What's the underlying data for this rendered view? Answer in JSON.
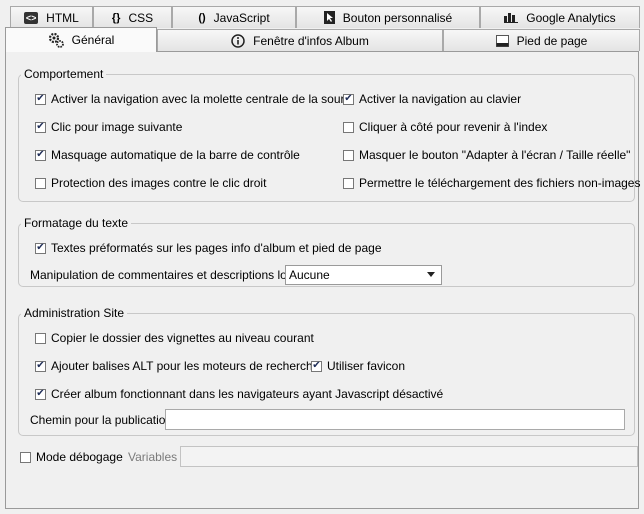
{
  "tabs_top": [
    {
      "label": "HTML",
      "icon": "html-icon"
    },
    {
      "label": "CSS",
      "icon": "css-braces-icon"
    },
    {
      "label": "JavaScript",
      "icon": "javascript-icon"
    },
    {
      "label": "Bouton personnalisé",
      "icon": "cursor-icon"
    },
    {
      "label": "Google Analytics",
      "icon": "bar-chart-icon"
    }
  ],
  "tabs_bottom": [
    {
      "label": "Général",
      "icon": "gear-icon",
      "active": true
    },
    {
      "label": "Fenêtre d'infos Album",
      "icon": "info-icon"
    },
    {
      "label": "Pied de page",
      "icon": "footer-icon"
    }
  ],
  "comportement": {
    "title": "Comportement",
    "items": [
      {
        "label": "Activer la navigation avec la molette centrale de la souris",
        "checked": true
      },
      {
        "label": "Activer la navigation au clavier",
        "checked": true
      },
      {
        "label": "Clic pour image suivante",
        "checked": true
      },
      {
        "label": "Cliquer à côté pour revenir à l'index",
        "checked": false
      },
      {
        "label": "Masquage automatique de la barre de contrôle",
        "checked": true
      },
      {
        "label": "Masquer le bouton \"Adapter à l'écran / Taille réelle\"",
        "checked": false
      },
      {
        "label": "Protection des images contre le clic droit",
        "checked": false
      },
      {
        "label": "Permettre le téléchargement des fichiers non-images",
        "checked": false
      }
    ]
  },
  "formatage": {
    "title": "Formatage du texte",
    "preformatted": {
      "label": "Textes préformatés sur les pages info d'album et pied de page",
      "checked": true
    },
    "manip_label": "Manipulation de commentaires et descriptions longs",
    "manip_value": "Aucune"
  },
  "admin": {
    "title": "Administration Site",
    "copy_thumbs": {
      "label": "Copier le dossier des vignettes au niveau courant",
      "checked": false
    },
    "alt_tags": {
      "label": "Ajouter balises ALT pour les moteurs de recherche",
      "checked": true
    },
    "favicon": {
      "label": "Utiliser favicon",
      "checked": true
    },
    "nojs": {
      "label": "Créer album fonctionnant dans les navigateurs ayant Javascript désactivé",
      "checked": true
    },
    "path_label": "Chemin pour la publication",
    "path_value": ""
  },
  "debug": {
    "label": "Mode débogage",
    "checked": false,
    "variables_label": "Variables",
    "variables_value": ""
  },
  "check_mark": "✔"
}
